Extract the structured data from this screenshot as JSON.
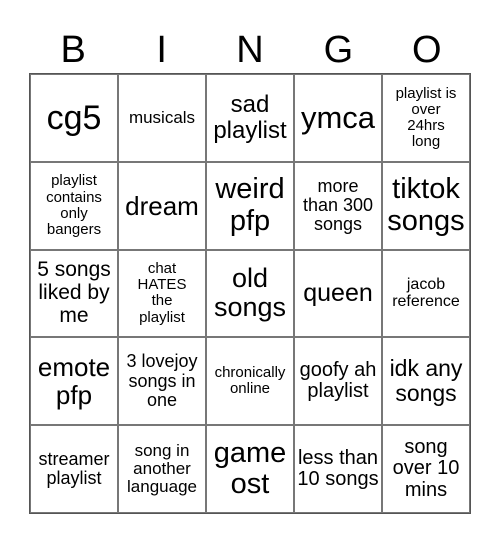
{
  "title_letters": [
    "B",
    "I",
    "N",
    "G",
    "O"
  ],
  "cells": [
    "cg5",
    "musicals",
    "sad playlist",
    "ymca",
    "playlist is over 24hrs long",
    "playlist contains only bangers",
    "dream",
    "weird pfp",
    "more than 300 songs",
    "tiktok songs",
    "5 songs liked by me",
    "chat HATES the playlist",
    "old songs",
    "queen",
    "jacob reference",
    "emote pfp",
    "3 lovejoy songs in one",
    "chronically online",
    "goofy ah playlist",
    "idk any songs",
    "streamer playlist",
    "song in another language",
    "game ost",
    "less than 10 songs",
    "song over 10 mins"
  ]
}
